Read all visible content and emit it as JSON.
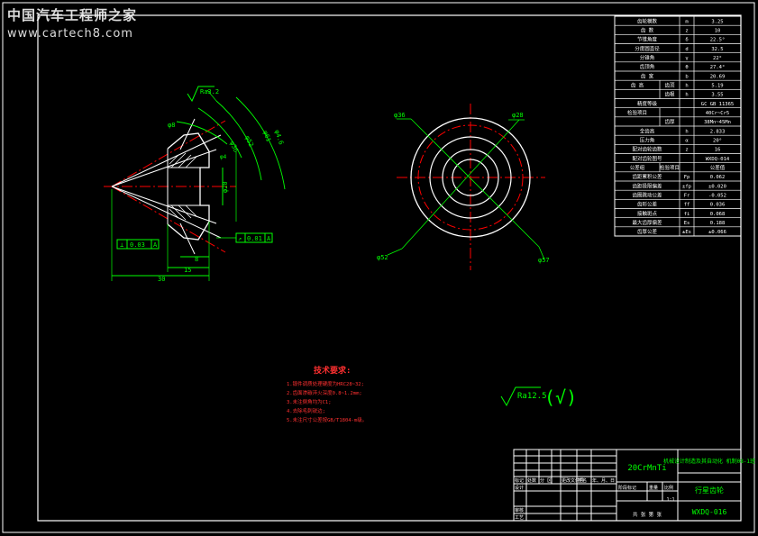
{
  "watermark": {
    "title": "中国汽车工程师之家",
    "url": "www.cartech8.com"
  },
  "colors": {
    "border": "#ffffff",
    "dim": "#00ff00",
    "center": "#ff0000",
    "part": "#ffffff",
    "text": "#ffffff",
    "note": "#ff3030",
    "hatch": "#ffffff"
  },
  "params_table": {
    "rows": [
      {
        "label": "齿轮模数",
        "sym": "m",
        "val": "3.25"
      },
      {
        "label": "齿 数",
        "sym": "z",
        "val": "10"
      },
      {
        "label": "节锥角度",
        "sym": "δ",
        "val": "22.5°"
      },
      {
        "label": "分度圆直径",
        "sym": "d",
        "val": "32.5"
      },
      {
        "label": "分锥角",
        "sym": "γ",
        "val": "22°"
      },
      {
        "label": "齿顶角",
        "sym": "θ",
        "val": "27.4°"
      },
      {
        "label": "齿 宽",
        "sym": "b",
        "val": "20.69"
      },
      {
        "label": "齿 高",
        "sub": "齿顶",
        "sym": "h",
        "val": "5.19"
      },
      {
        "label": "",
        "sub": "齿根",
        "sym": "h",
        "val": "3.55"
      },
      {
        "label": "精度等级",
        "sym": "",
        "val": "GC GB 11365"
      },
      {
        "label": "检验项目",
        "sub": "",
        "sym": "",
        "val": "40Cr~Cr5"
      },
      {
        "label": "",
        "sub": "齿厚",
        "sym": "",
        "val": "38Mn~45Mn"
      },
      {
        "label": "全齿高",
        "sym": "h",
        "val": "2.833"
      },
      {
        "label": "压力角",
        "sym": "α",
        "val": "20°"
      },
      {
        "label": "配对齿轮齿数",
        "sym": "z",
        "val": "16"
      },
      {
        "label": "配对齿轮图号",
        "sym": "",
        "val": "WXDQ-014"
      },
      {
        "label": "公差组",
        "sub": "检验项目",
        "sym": "",
        "val": "公差值"
      },
      {
        "label": "齿距累积公差",
        "sym": "Fp",
        "val": "0.062"
      },
      {
        "label": "齿距极限偏差",
        "sym": "±fp",
        "val": "±0.020"
      },
      {
        "label": "齿圈跳动公差",
        "sym": "Fr",
        "val": "-0.052"
      },
      {
        "label": "齿形公差",
        "sym": "ff",
        "val": "0.036"
      },
      {
        "label": "接触斑点",
        "sym": "fi",
        "val": "0.068"
      },
      {
        "label": "最大齿厚偏差",
        "sym": "Es",
        "val": "0.188"
      },
      {
        "label": "齿厚公差",
        "sym": "±Es",
        "val": "±0.066"
      }
    ]
  },
  "dims": {
    "overall_length": "30",
    "hub_length": "15",
    "face": "8",
    "tol_flat": "0.03",
    "datum_a": "A",
    "tol_perp": "0.01",
    "surface_finish": "Ra3.2",
    "cone1": "φ36",
    "cone2": "φ52",
    "cone3": "φ61",
    "cone4": "φ4.6",
    "bore": "φ20",
    "tilt1": "φ8",
    "tilt2": "φ4"
  },
  "end_view": {
    "d1": "φ36",
    "d2": "φ28",
    "d3": "φ52",
    "d4": "φ57"
  },
  "notes": {
    "title": "技术要求:",
    "items": [
      "1.锻件调质处理硬度为HRC28~32;",
      "2.齿面渗碳淬火深度0.8~1.2mm;",
      "3.未注倒角均为C1;",
      "4.去除毛刺锐边;",
      "5.未注尺寸公差按GB/T1804-m级。"
    ]
  },
  "surface_mark": {
    "value": "Ra12.5",
    "paren": "(√)"
  },
  "title_block": {
    "material": "20CrMnTi",
    "company": "机械设计制造及其自动化 机制08-1班",
    "part_name": "行星齿轮",
    "drawing_no": "WXDQ-016",
    "scale": "1:1",
    "headers": [
      "标记",
      "处数",
      "分 区",
      "更改文件号",
      "签名",
      "年、月、日"
    ],
    "rows": [
      "设计",
      "审核",
      "工艺"
    ],
    "stage_labels": [
      "阶段标记",
      "重量",
      "比例"
    ],
    "sheet": "共 张 第 张"
  }
}
